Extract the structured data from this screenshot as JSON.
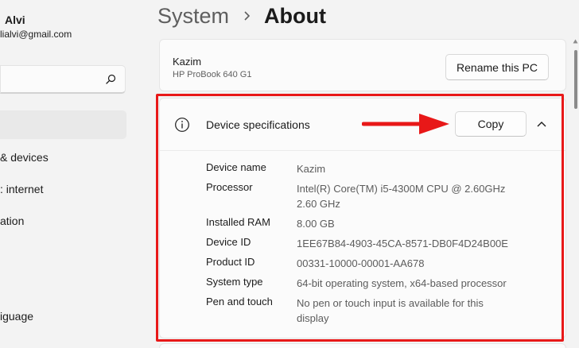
{
  "user": {
    "name": "Alvi",
    "email": "lialvi@gmail.com"
  },
  "search": {
    "value": "",
    "placeholder": ""
  },
  "sidebar": {
    "items": [
      {
        "label": "& devices"
      },
      {
        "label": ": internet"
      },
      {
        "label": "ation"
      },
      {
        "label": "iguage"
      }
    ]
  },
  "header": {
    "parent": "System",
    "current": "About"
  },
  "pc": {
    "name": "Kazim",
    "model": "HP ProBook 640 G1",
    "rename_label": "Rename this PC"
  },
  "specs": {
    "title": "Device specifications",
    "copy_label": "Copy",
    "rows": [
      {
        "label": "Device name",
        "value": "Kazim"
      },
      {
        "label": "Processor",
        "value": "Intel(R) Core(TM) i5-4300M CPU @ 2.60GHz 2.60 GHz"
      },
      {
        "label": "Installed RAM",
        "value": "8.00 GB"
      },
      {
        "label": "Device ID",
        "value": "1EE67B84-4903-45CA-8571-DB0F4D24B00E"
      },
      {
        "label": "Product ID",
        "value": "00331-10000-00001-AA678"
      },
      {
        "label": "System type",
        "value": "64-bit operating system, x64-based processor"
      },
      {
        "label": "Pen and touch",
        "value": "No pen or touch input is available for this display"
      }
    ]
  },
  "icons": {
    "search": "search-icon",
    "info": "info-icon",
    "chevron": "chevron-up-icon",
    "separator": "chevron-right-icon",
    "annotation": "arrow-right-icon"
  },
  "colors": {
    "annotation": "#e81818",
    "background": "#f3f3f3",
    "card": "#fbfbfb"
  }
}
